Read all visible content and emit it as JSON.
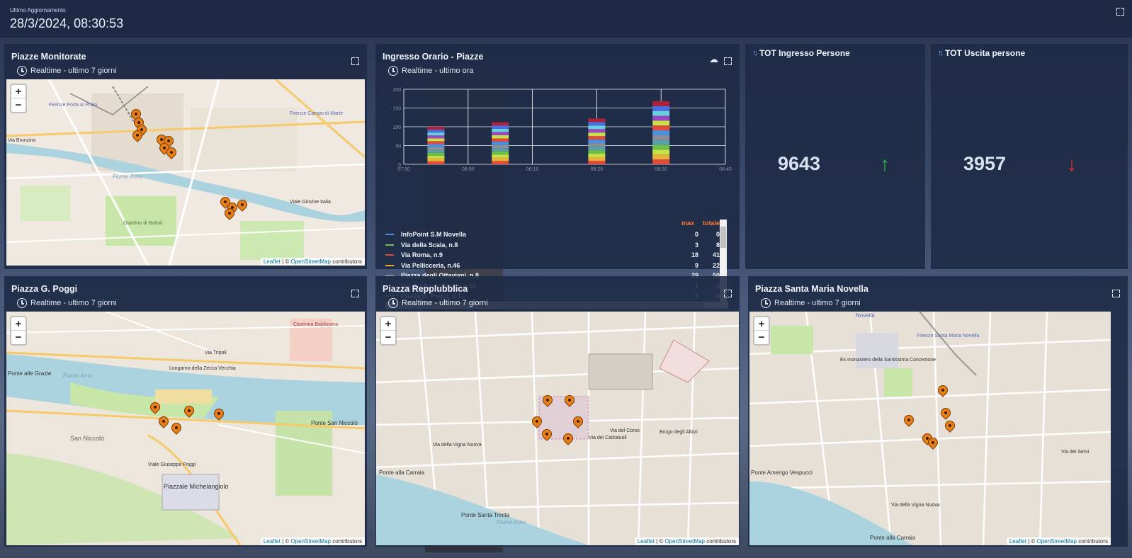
{
  "header": {
    "label": "Ultimo Aggiornamento",
    "datetime": "28/3/2024, 08:30:53"
  },
  "panels": {
    "piazze_monitorate": {
      "title": "Piazze Monitorate",
      "subtitle": "Realtime - ultimo 7 giorni"
    },
    "ingresso_orario": {
      "title": "Ingresso Orario - Piazze",
      "subtitle": "Realtime - ultimo ora"
    },
    "tot_ingresso": {
      "title": "TOT Ingresso Persone",
      "value": "9643",
      "trend": "↑"
    },
    "tot_uscita": {
      "title": "TOT Uscita persone",
      "value": "3957",
      "trend": "↓"
    },
    "piazza_poggi": {
      "title": "Piazza G. Poggi",
      "subtitle": "Realtime - ultimo 7 giorni"
    },
    "piazza_repubblica": {
      "title": "Piazza Repplubblica",
      "subtitle": "Realtime - ultimo 7 giorni"
    },
    "piazza_smn": {
      "title": "Piazza Santa Maria Novella",
      "subtitle": "Realtime - ultimo 7 giorni"
    }
  },
  "map_common": {
    "zoom_in": "+",
    "zoom_out": "−",
    "attribution_leaflet": "Leaflet",
    "attribution_sep": " | © ",
    "attribution_osm": "OpenStreetMap",
    "attribution_tail": " contributors"
  },
  "map_labels": {
    "m1": [
      "Fiume Arno",
      "Firenze Porta al Prato",
      "Firenze Campo di Marte",
      "Giardino di Boboli",
      "Via Bronzino",
      "Viale Giovine Italia"
    ],
    "m2": [
      "Fiume Arno",
      "Piazzale Michelangiolo",
      "Ponte alle Grazie",
      "Ponte San Niccolò",
      "San Niccolò",
      "Lungarno della Zecca Vecchia",
      "Via Tripoli",
      "Viale Giuseppe Poggi",
      "Caserma Baldissera"
    ],
    "m3": [
      "Fiume Arno",
      "Ponte alla Carraia",
      "Ponte Santa Trinita",
      "Via della Vigna Nuova",
      "Borgo degli Albizi",
      "Via dei Calzaiuoli",
      "Via del Corso"
    ],
    "m4": [
      "Novella",
      "Ex monastero della Santissima Concezione",
      "Ponte Amerigo Vespucci",
      "Ponte alla Carraia",
      "Via della Vigna Nuova",
      "Via dei Servi",
      "Firenze Santa Maria Novella"
    ]
  },
  "chart_data": {
    "type": "bar",
    "stacked": true,
    "ylim": [
      0,
      200
    ],
    "yticks": [
      0,
      50,
      100,
      150,
      200
    ],
    "xticks": [
      "07:50",
      "08:00",
      "08:10",
      "08:20",
      "08:30",
      "08:40"
    ],
    "bars": [
      {
        "x": "07:55",
        "total": 100
      },
      {
        "x": "08:05",
        "total": 112
      },
      {
        "x": "08:20",
        "total": 122
      },
      {
        "x": "08:30",
        "total": 168
      }
    ],
    "legend_headers": {
      "max": "max",
      "totale": "totale"
    },
    "legend": [
      {
        "name": "InfoPoint S.M Novella",
        "color": "#4a8fe0",
        "max": "0",
        "totale": "0"
      },
      {
        "name": "Via della Scala, n.8",
        "color": "#6cc04a",
        "max": "3",
        "totale": "8"
      },
      {
        "name": "Via Roma, n.9",
        "color": "#e24a3a",
        "max": "18",
        "totale": "41"
      },
      {
        "name": "Via Pellicceria, n.46",
        "color": "#e6b43a",
        "max": "9",
        "totale": "22"
      },
      {
        "name": "Piazza degli Ottaviani, n.8",
        "color": "#8a8f99",
        "max": "29",
        "totale": "50"
      },
      {
        "name": "Via dei Brunelleschi,n.10",
        "color": "#9a4ac0",
        "max": "1",
        "totale": "2"
      },
      {
        "name": "Piazza G. Poggi, n.1",
        "color": "#c8e04a",
        "max": "5",
        "totale": "6"
      }
    ],
    "segment_colors": [
      "#e24a3a",
      "#e6b43a",
      "#c8e04a",
      "#6cc04a",
      "#5aa0a8",
      "#8a8f99",
      "#4a8fe0",
      "#e24a3a",
      "#c8e04a",
      "#9a4ac0",
      "#6ad0e0",
      "#4a6fe0",
      "#b0203a"
    ]
  }
}
